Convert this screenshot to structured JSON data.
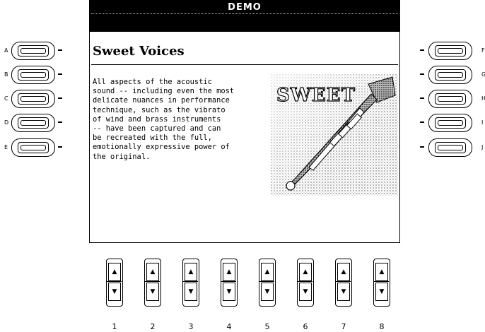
{
  "screen": {
    "title": "DEMO",
    "voice_title": "Sweet Voices",
    "body_text": "All aspects of the acoustic\nsound -- including even the most\ndelicate nuances in performance\ntechnique, such as the vibrato\nof wind and brass instruments\n-- have been captured and can\nbe recreated with the full,\nemotionally expressive power of\nthe original.",
    "image_label": "SWEET",
    "image_icon": "trumpet-icon"
  },
  "left_buttons": [
    {
      "letter": "A"
    },
    {
      "letter": "B"
    },
    {
      "letter": "C"
    },
    {
      "letter": "D"
    },
    {
      "letter": "E"
    }
  ],
  "right_buttons": [
    {
      "letter": "F"
    },
    {
      "letter": "G"
    },
    {
      "letter": "H"
    },
    {
      "letter": "I"
    },
    {
      "letter": "J"
    }
  ],
  "bottom_buttons": [
    {
      "number": "1",
      "up": "▲",
      "down": "▼"
    },
    {
      "number": "2",
      "up": "▲",
      "down": "▼"
    },
    {
      "number": "3",
      "up": "▲",
      "down": "▼"
    },
    {
      "number": "4",
      "up": "▲",
      "down": "▼"
    },
    {
      "number": "5",
      "up": "▲",
      "down": "▼"
    },
    {
      "number": "6",
      "up": "▲",
      "down": "▼"
    },
    {
      "number": "7",
      "up": "▲",
      "down": "▼"
    },
    {
      "number": "8",
      "up": "▲",
      "down": "▼"
    }
  ]
}
